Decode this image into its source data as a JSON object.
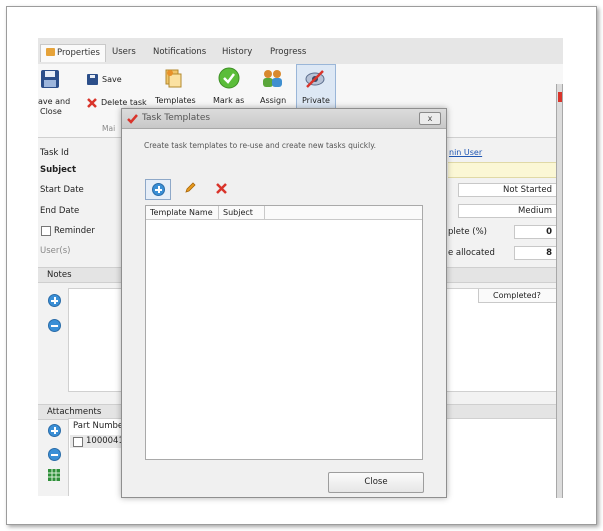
{
  "tabs": [
    "Properties",
    "Users",
    "Notifications",
    "History",
    "Progress"
  ],
  "ribbon": {
    "save_close_line1": "ave and",
    "save_close_line2": "Close",
    "save": "Save",
    "delete_task": "Delete task",
    "templates": "Templates",
    "mark_as": "Mark as",
    "assign": "Assign",
    "private": "Private",
    "group_label": "Mai"
  },
  "form": {
    "task_id": "Task Id",
    "subject": "Subject",
    "start_date": "Start Date",
    "end_date": "End Date",
    "reminder": "Reminder",
    "users": "User(s)",
    "admin_user": "nin User",
    "status": "Not Started",
    "priority": "Medium",
    "complete_label": "plete (%)",
    "complete_value": "0",
    "allocated_label": "e allocated",
    "allocated_value": "8"
  },
  "notes": {
    "header": "Notes",
    "completed_col": "Completed?"
  },
  "attachments": {
    "header": "Attachments",
    "part_number_col": "Part Number",
    "row_value": "1000041"
  },
  "dialog": {
    "title": "Task Templates",
    "close_x": "x",
    "description": "Create task templates to re-use and create new tasks quickly.",
    "columns": [
      "Template Name",
      "Subject"
    ],
    "close_button": "Close"
  },
  "colors": {
    "accent_blue": "#3a8fd6",
    "delete_red": "#d9342b",
    "edit_orange": "#e89a1c"
  }
}
